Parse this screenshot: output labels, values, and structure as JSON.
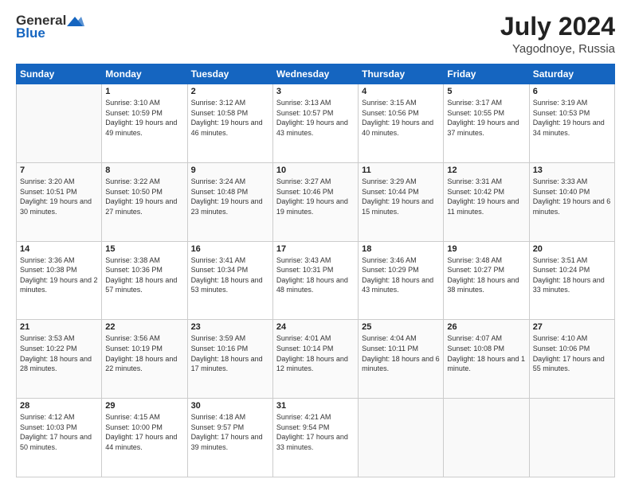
{
  "logo": {
    "general": "General",
    "blue": "Blue"
  },
  "header": {
    "month_year": "July 2024",
    "location": "Yagodnoye, Russia"
  },
  "days_of_week": [
    "Sunday",
    "Monday",
    "Tuesday",
    "Wednesday",
    "Thursday",
    "Friday",
    "Saturday"
  ],
  "weeks": [
    [
      {
        "day": "",
        "sunrise": "",
        "sunset": "",
        "daylight": ""
      },
      {
        "day": "1",
        "sunrise": "Sunrise: 3:10 AM",
        "sunset": "Sunset: 10:59 PM",
        "daylight": "Daylight: 19 hours and 49 minutes."
      },
      {
        "day": "2",
        "sunrise": "Sunrise: 3:12 AM",
        "sunset": "Sunset: 10:58 PM",
        "daylight": "Daylight: 19 hours and 46 minutes."
      },
      {
        "day": "3",
        "sunrise": "Sunrise: 3:13 AM",
        "sunset": "Sunset: 10:57 PM",
        "daylight": "Daylight: 19 hours and 43 minutes."
      },
      {
        "day": "4",
        "sunrise": "Sunrise: 3:15 AM",
        "sunset": "Sunset: 10:56 PM",
        "daylight": "Daylight: 19 hours and 40 minutes."
      },
      {
        "day": "5",
        "sunrise": "Sunrise: 3:17 AM",
        "sunset": "Sunset: 10:55 PM",
        "daylight": "Daylight: 19 hours and 37 minutes."
      },
      {
        "day": "6",
        "sunrise": "Sunrise: 3:19 AM",
        "sunset": "Sunset: 10:53 PM",
        "daylight": "Daylight: 19 hours and 34 minutes."
      }
    ],
    [
      {
        "day": "7",
        "sunrise": "Sunrise: 3:20 AM",
        "sunset": "Sunset: 10:51 PM",
        "daylight": "Daylight: 19 hours and 30 minutes."
      },
      {
        "day": "8",
        "sunrise": "Sunrise: 3:22 AM",
        "sunset": "Sunset: 10:50 PM",
        "daylight": "Daylight: 19 hours and 27 minutes."
      },
      {
        "day": "9",
        "sunrise": "Sunrise: 3:24 AM",
        "sunset": "Sunset: 10:48 PM",
        "daylight": "Daylight: 19 hours and 23 minutes."
      },
      {
        "day": "10",
        "sunrise": "Sunrise: 3:27 AM",
        "sunset": "Sunset: 10:46 PM",
        "daylight": "Daylight: 19 hours and 19 minutes."
      },
      {
        "day": "11",
        "sunrise": "Sunrise: 3:29 AM",
        "sunset": "Sunset: 10:44 PM",
        "daylight": "Daylight: 19 hours and 15 minutes."
      },
      {
        "day": "12",
        "sunrise": "Sunrise: 3:31 AM",
        "sunset": "Sunset: 10:42 PM",
        "daylight": "Daylight: 19 hours and 11 minutes."
      },
      {
        "day": "13",
        "sunrise": "Sunrise: 3:33 AM",
        "sunset": "Sunset: 10:40 PM",
        "daylight": "Daylight: 19 hours and 6 minutes."
      }
    ],
    [
      {
        "day": "14",
        "sunrise": "Sunrise: 3:36 AM",
        "sunset": "Sunset: 10:38 PM",
        "daylight": "Daylight: 19 hours and 2 minutes."
      },
      {
        "day": "15",
        "sunrise": "Sunrise: 3:38 AM",
        "sunset": "Sunset: 10:36 PM",
        "daylight": "Daylight: 18 hours and 57 minutes."
      },
      {
        "day": "16",
        "sunrise": "Sunrise: 3:41 AM",
        "sunset": "Sunset: 10:34 PM",
        "daylight": "Daylight: 18 hours and 53 minutes."
      },
      {
        "day": "17",
        "sunrise": "Sunrise: 3:43 AM",
        "sunset": "Sunset: 10:31 PM",
        "daylight": "Daylight: 18 hours and 48 minutes."
      },
      {
        "day": "18",
        "sunrise": "Sunrise: 3:46 AM",
        "sunset": "Sunset: 10:29 PM",
        "daylight": "Daylight: 18 hours and 43 minutes."
      },
      {
        "day": "19",
        "sunrise": "Sunrise: 3:48 AM",
        "sunset": "Sunset: 10:27 PM",
        "daylight": "Daylight: 18 hours and 38 minutes."
      },
      {
        "day": "20",
        "sunrise": "Sunrise: 3:51 AM",
        "sunset": "Sunset: 10:24 PM",
        "daylight": "Daylight: 18 hours and 33 minutes."
      }
    ],
    [
      {
        "day": "21",
        "sunrise": "Sunrise: 3:53 AM",
        "sunset": "Sunset: 10:22 PM",
        "daylight": "Daylight: 18 hours and 28 minutes."
      },
      {
        "day": "22",
        "sunrise": "Sunrise: 3:56 AM",
        "sunset": "Sunset: 10:19 PM",
        "daylight": "Daylight: 18 hours and 22 minutes."
      },
      {
        "day": "23",
        "sunrise": "Sunrise: 3:59 AM",
        "sunset": "Sunset: 10:16 PM",
        "daylight": "Daylight: 18 hours and 17 minutes."
      },
      {
        "day": "24",
        "sunrise": "Sunrise: 4:01 AM",
        "sunset": "Sunset: 10:14 PM",
        "daylight": "Daylight: 18 hours and 12 minutes."
      },
      {
        "day": "25",
        "sunrise": "Sunrise: 4:04 AM",
        "sunset": "Sunset: 10:11 PM",
        "daylight": "Daylight: 18 hours and 6 minutes."
      },
      {
        "day": "26",
        "sunrise": "Sunrise: 4:07 AM",
        "sunset": "Sunset: 10:08 PM",
        "daylight": "Daylight: 18 hours and 1 minute."
      },
      {
        "day": "27",
        "sunrise": "Sunrise: 4:10 AM",
        "sunset": "Sunset: 10:06 PM",
        "daylight": "Daylight: 17 hours and 55 minutes."
      }
    ],
    [
      {
        "day": "28",
        "sunrise": "Sunrise: 4:12 AM",
        "sunset": "Sunset: 10:03 PM",
        "daylight": "Daylight: 17 hours and 50 minutes."
      },
      {
        "day": "29",
        "sunrise": "Sunrise: 4:15 AM",
        "sunset": "Sunset: 10:00 PM",
        "daylight": "Daylight: 17 hours and 44 minutes."
      },
      {
        "day": "30",
        "sunrise": "Sunrise: 4:18 AM",
        "sunset": "Sunset: 9:57 PM",
        "daylight": "Daylight: 17 hours and 39 minutes."
      },
      {
        "day": "31",
        "sunrise": "Sunrise: 4:21 AM",
        "sunset": "Sunset: 9:54 PM",
        "daylight": "Daylight: 17 hours and 33 minutes."
      },
      {
        "day": "",
        "sunrise": "",
        "sunset": "",
        "daylight": ""
      },
      {
        "day": "",
        "sunrise": "",
        "sunset": "",
        "daylight": ""
      },
      {
        "day": "",
        "sunrise": "",
        "sunset": "",
        "daylight": ""
      }
    ]
  ]
}
